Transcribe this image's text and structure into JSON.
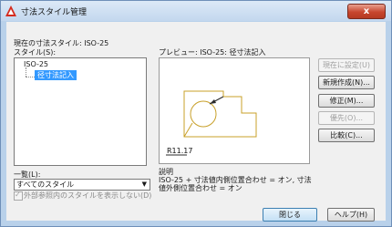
{
  "window": {
    "title": "寸法スタイル管理",
    "close_label": "x"
  },
  "current_style": "現在の寸法スタイル: ISO-25",
  "styles_label": "スタイル(S):",
  "styles_tree": {
    "root": "ISO-25",
    "child": "径寸法記入"
  },
  "preview_label": "プレビュー: ISO-25: 径寸法記入",
  "preview": {
    "dimension_text": "R11.17"
  },
  "description": {
    "label": "説明",
    "line1": "ISO-25 + 寸法値内側位置合わせ = オン, 寸法",
    "line2": "値外側位置合わせ = オン"
  },
  "list_label": "一覧(L):",
  "list_combo": {
    "value": "すべてのスタイル"
  },
  "checkbox_label": "外部参照内のスタイルを表示しない(D)",
  "buttons": {
    "set_current": "現在に設定(U)",
    "new": "新規作成(N)...",
    "modify": "修正(M)...",
    "override": "優先(O)...",
    "compare": "比較(C)...",
    "close": "閉じる",
    "help": "ヘルプ(H)"
  },
  "colors": {
    "preview_geometry": "#c8a02a",
    "selection": "#3399ff"
  }
}
